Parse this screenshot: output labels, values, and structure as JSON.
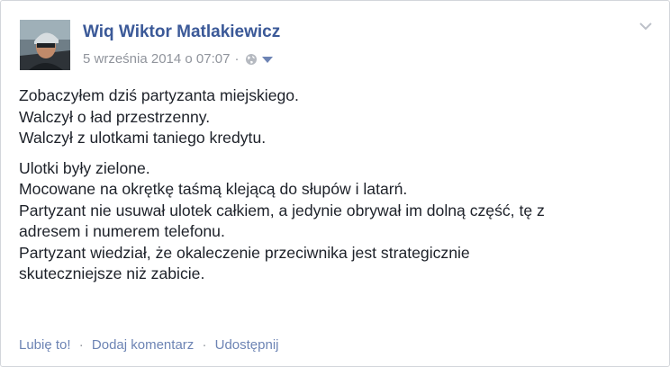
{
  "post": {
    "author": "Wiq Wiktor Matlakiewicz",
    "timestamp": "5 września 2014 o 07:07",
    "separator": "·",
    "audience_icon": "globe-icon",
    "menu_icon": "chevron-down-icon",
    "paragraphs": [
      {
        "lines": [
          "Zobaczyłem dziś partyzanta miejskiego.",
          "Walczył o ład przestrzenny.",
          "Walczył z ulotkami taniego kredytu."
        ]
      },
      {
        "lines": [
          "Ulotki były zielone.",
          "Mocowane na okrętkę taśmą klejącą do słupów i latarń.",
          "Partyzant nie usuwał ulotek całkiem, a jedynie obrywał im dolną część, tę z",
          "adresem i numerem telefonu.",
          "Partyzant wiedział, że okaleczenie przeciwnika jest strategicznie",
          "skuteczniejsze niż zabicie."
        ]
      }
    ]
  },
  "actions": {
    "like": "Lubię to!",
    "comment": "Dodaj komentarz",
    "share": "Udostępnij",
    "separator": "·"
  },
  "colors": {
    "link": "#3b5998",
    "action_link": "#6d84b4",
    "meta": "#90949c",
    "text": "#1d2129",
    "border": "#d3d6db"
  }
}
